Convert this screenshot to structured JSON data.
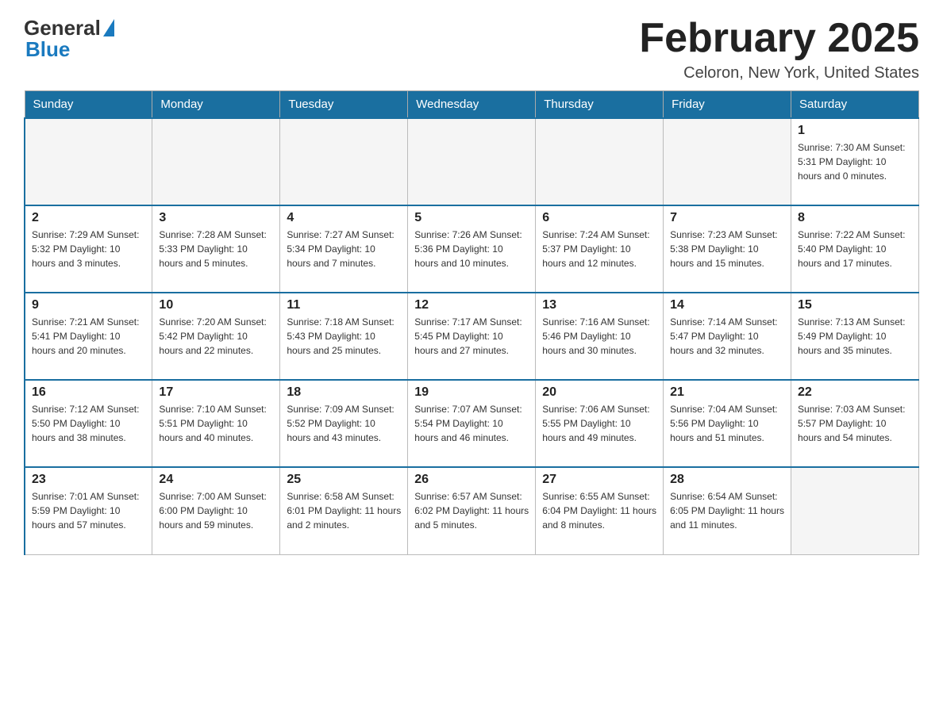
{
  "logo": {
    "general": "General",
    "blue": "Blue"
  },
  "header": {
    "title": "February 2025",
    "location": "Celoron, New York, United States"
  },
  "days_of_week": [
    "Sunday",
    "Monday",
    "Tuesday",
    "Wednesday",
    "Thursday",
    "Friday",
    "Saturday"
  ],
  "weeks": [
    [
      {
        "day": "",
        "info": ""
      },
      {
        "day": "",
        "info": ""
      },
      {
        "day": "",
        "info": ""
      },
      {
        "day": "",
        "info": ""
      },
      {
        "day": "",
        "info": ""
      },
      {
        "day": "",
        "info": ""
      },
      {
        "day": "1",
        "info": "Sunrise: 7:30 AM\nSunset: 5:31 PM\nDaylight: 10 hours and 0 minutes."
      }
    ],
    [
      {
        "day": "2",
        "info": "Sunrise: 7:29 AM\nSunset: 5:32 PM\nDaylight: 10 hours and 3 minutes."
      },
      {
        "day": "3",
        "info": "Sunrise: 7:28 AM\nSunset: 5:33 PM\nDaylight: 10 hours and 5 minutes."
      },
      {
        "day": "4",
        "info": "Sunrise: 7:27 AM\nSunset: 5:34 PM\nDaylight: 10 hours and 7 minutes."
      },
      {
        "day": "5",
        "info": "Sunrise: 7:26 AM\nSunset: 5:36 PM\nDaylight: 10 hours and 10 minutes."
      },
      {
        "day": "6",
        "info": "Sunrise: 7:24 AM\nSunset: 5:37 PM\nDaylight: 10 hours and 12 minutes."
      },
      {
        "day": "7",
        "info": "Sunrise: 7:23 AM\nSunset: 5:38 PM\nDaylight: 10 hours and 15 minutes."
      },
      {
        "day": "8",
        "info": "Sunrise: 7:22 AM\nSunset: 5:40 PM\nDaylight: 10 hours and 17 minutes."
      }
    ],
    [
      {
        "day": "9",
        "info": "Sunrise: 7:21 AM\nSunset: 5:41 PM\nDaylight: 10 hours and 20 minutes."
      },
      {
        "day": "10",
        "info": "Sunrise: 7:20 AM\nSunset: 5:42 PM\nDaylight: 10 hours and 22 minutes."
      },
      {
        "day": "11",
        "info": "Sunrise: 7:18 AM\nSunset: 5:43 PM\nDaylight: 10 hours and 25 minutes."
      },
      {
        "day": "12",
        "info": "Sunrise: 7:17 AM\nSunset: 5:45 PM\nDaylight: 10 hours and 27 minutes."
      },
      {
        "day": "13",
        "info": "Sunrise: 7:16 AM\nSunset: 5:46 PM\nDaylight: 10 hours and 30 minutes."
      },
      {
        "day": "14",
        "info": "Sunrise: 7:14 AM\nSunset: 5:47 PM\nDaylight: 10 hours and 32 minutes."
      },
      {
        "day": "15",
        "info": "Sunrise: 7:13 AM\nSunset: 5:49 PM\nDaylight: 10 hours and 35 minutes."
      }
    ],
    [
      {
        "day": "16",
        "info": "Sunrise: 7:12 AM\nSunset: 5:50 PM\nDaylight: 10 hours and 38 minutes."
      },
      {
        "day": "17",
        "info": "Sunrise: 7:10 AM\nSunset: 5:51 PM\nDaylight: 10 hours and 40 minutes."
      },
      {
        "day": "18",
        "info": "Sunrise: 7:09 AM\nSunset: 5:52 PM\nDaylight: 10 hours and 43 minutes."
      },
      {
        "day": "19",
        "info": "Sunrise: 7:07 AM\nSunset: 5:54 PM\nDaylight: 10 hours and 46 minutes."
      },
      {
        "day": "20",
        "info": "Sunrise: 7:06 AM\nSunset: 5:55 PM\nDaylight: 10 hours and 49 minutes."
      },
      {
        "day": "21",
        "info": "Sunrise: 7:04 AM\nSunset: 5:56 PM\nDaylight: 10 hours and 51 minutes."
      },
      {
        "day": "22",
        "info": "Sunrise: 7:03 AM\nSunset: 5:57 PM\nDaylight: 10 hours and 54 minutes."
      }
    ],
    [
      {
        "day": "23",
        "info": "Sunrise: 7:01 AM\nSunset: 5:59 PM\nDaylight: 10 hours and 57 minutes."
      },
      {
        "day": "24",
        "info": "Sunrise: 7:00 AM\nSunset: 6:00 PM\nDaylight: 10 hours and 59 minutes."
      },
      {
        "day": "25",
        "info": "Sunrise: 6:58 AM\nSunset: 6:01 PM\nDaylight: 11 hours and 2 minutes."
      },
      {
        "day": "26",
        "info": "Sunrise: 6:57 AM\nSunset: 6:02 PM\nDaylight: 11 hours and 5 minutes."
      },
      {
        "day": "27",
        "info": "Sunrise: 6:55 AM\nSunset: 6:04 PM\nDaylight: 11 hours and 8 minutes."
      },
      {
        "day": "28",
        "info": "Sunrise: 6:54 AM\nSunset: 6:05 PM\nDaylight: 11 hours and 11 minutes."
      },
      {
        "day": "",
        "info": ""
      }
    ]
  ]
}
